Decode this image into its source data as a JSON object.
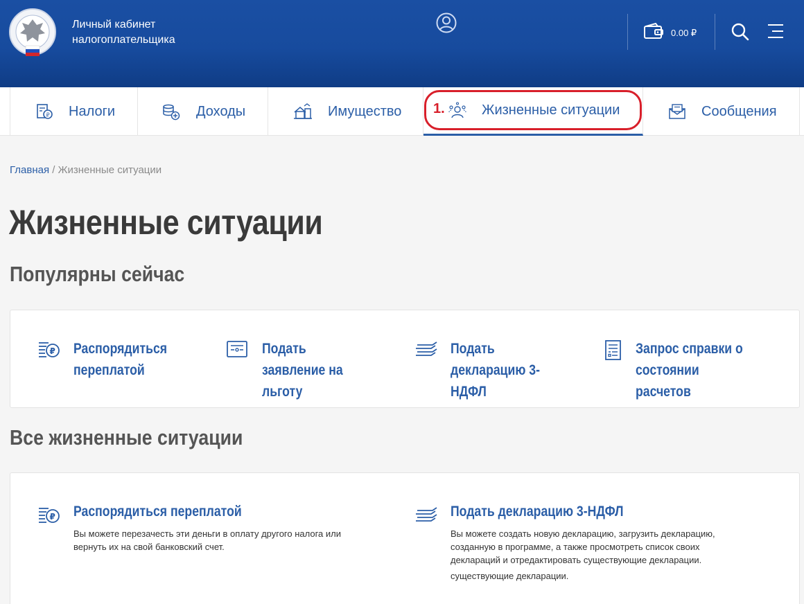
{
  "header": {
    "brand_line1": "Личный кабинет",
    "brand_line2": "налогоплательщика",
    "wallet_amount": "0.00 ₽",
    "icons": [
      "fns-emblem-logo",
      "user-icon",
      "wallet-icon",
      "search-icon",
      "menu-icon"
    ]
  },
  "tabs": [
    {
      "label": "Налоги",
      "icon": "tax-receipt-icon"
    },
    {
      "label": "Доходы",
      "icon": "income-coins-icon"
    },
    {
      "label": "Имущество",
      "icon": "property-icon"
    },
    {
      "label": "Жизненные ситуации",
      "icon": "people-icon",
      "active": true
    },
    {
      "label": "Сообщения",
      "icon": "envelope-icon"
    }
  ],
  "annotation": {
    "number": "1."
  },
  "breadcrumb": {
    "home": "Главная",
    "separator": " / ",
    "current": "Жизненные ситуации"
  },
  "page": {
    "title": "Жизненные ситуации",
    "popular_title": "Популярны сейчас",
    "all_title": "Все жизненные ситуации"
  },
  "popular": [
    {
      "label": "Распорядиться переплатой",
      "icon": "overpayment-icon"
    },
    {
      "label": "Подать заявление на льготу",
      "icon": "application-icon"
    },
    {
      "label": "Подать декларацию 3-НДФЛ",
      "icon": "declaration-icon"
    },
    {
      "label": "Запрос справки о состоянии расчетов",
      "icon": "certificate-request-icon"
    }
  ],
  "all": [
    {
      "title": "Распорядиться переплатой",
      "icon": "overpayment-icon",
      "desc": "Вы можете перезачесть эти деньги в оплату другого налога или вернуть их на свой банковский счет."
    },
    {
      "title": "Подать декларацию 3-НДФЛ",
      "icon": "declaration-icon",
      "desc": "Вы можете создать новую декларацию, загрузить декларацию, созданную в программе, а также просмотреть список своих деклараций и отредактировать существующие декларации.",
      "desc_extra": "существующие декларации."
    }
  ],
  "colors": {
    "header_blue": "#174b9e",
    "link_blue": "#2b5ea7",
    "highlight_red": "#d81f2a"
  }
}
